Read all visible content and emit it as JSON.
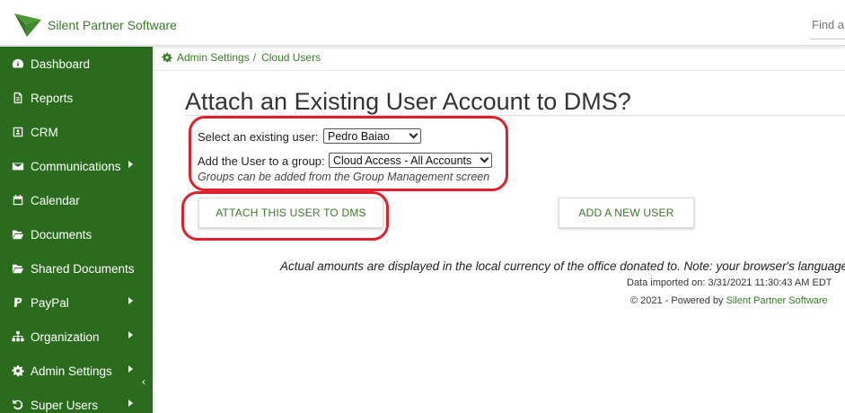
{
  "header": {
    "brand": "Silent Partner Software",
    "search_placeholder": "Find a"
  },
  "sidebar": {
    "items": [
      {
        "label": "Dashboard",
        "icon": "dashboard-icon",
        "has_submenu": false
      },
      {
        "label": "Reports",
        "icon": "report-icon",
        "has_submenu": false
      },
      {
        "label": "CRM",
        "icon": "contact-card-icon",
        "has_submenu": false
      },
      {
        "label": "Communications",
        "icon": "envelope-icon",
        "has_submenu": true
      },
      {
        "label": "Calendar",
        "icon": "calendar-icon",
        "has_submenu": false
      },
      {
        "label": "Documents",
        "icon": "folder-open-icon",
        "has_submenu": false
      },
      {
        "label": "Shared Documents",
        "icon": "folder-open-icon",
        "has_submenu": false
      },
      {
        "label": "PayPal",
        "icon": "paypal-icon",
        "has_submenu": true
      },
      {
        "label": "Organization",
        "icon": "sitemap-icon",
        "has_submenu": true
      },
      {
        "label": "Admin Settings",
        "icon": "gear-icon",
        "has_submenu": true
      },
      {
        "label": "Super Users",
        "icon": "refresh-icon",
        "has_submenu": true
      }
    ],
    "collapse_glyph": "‹"
  },
  "breadcrumb": {
    "items": [
      "Admin Settings",
      "Cloud Users"
    ],
    "separator": "/"
  },
  "main": {
    "title": "Attach an Existing User Account to DMS?",
    "select_user_label": "Select an existing user:",
    "select_user_value": "Pedro Baiao",
    "group_label": "Add the User to a group:",
    "group_value": "Cloud Access - All Accounts",
    "group_hint": "Groups can be added from the Group Management screen",
    "attach_button": "ATTACH THIS USER TO DMS",
    "add_new_button": "ADD A NEW USER"
  },
  "footer": {
    "currency_note": "Actual amounts are displayed in the local currency of the office donated to. Note: your browser's language",
    "data_imported": "Data imported on: 3/31/2021 11:30:43 AM EDT",
    "copyright_prefix": "© 2021 - Powered by",
    "copyright_link": "Silent Partner Software"
  },
  "colors": {
    "brand_green": "#3a7a2a",
    "sidebar_green": "#2a6b1e",
    "annotation_red": "#e0202f"
  }
}
